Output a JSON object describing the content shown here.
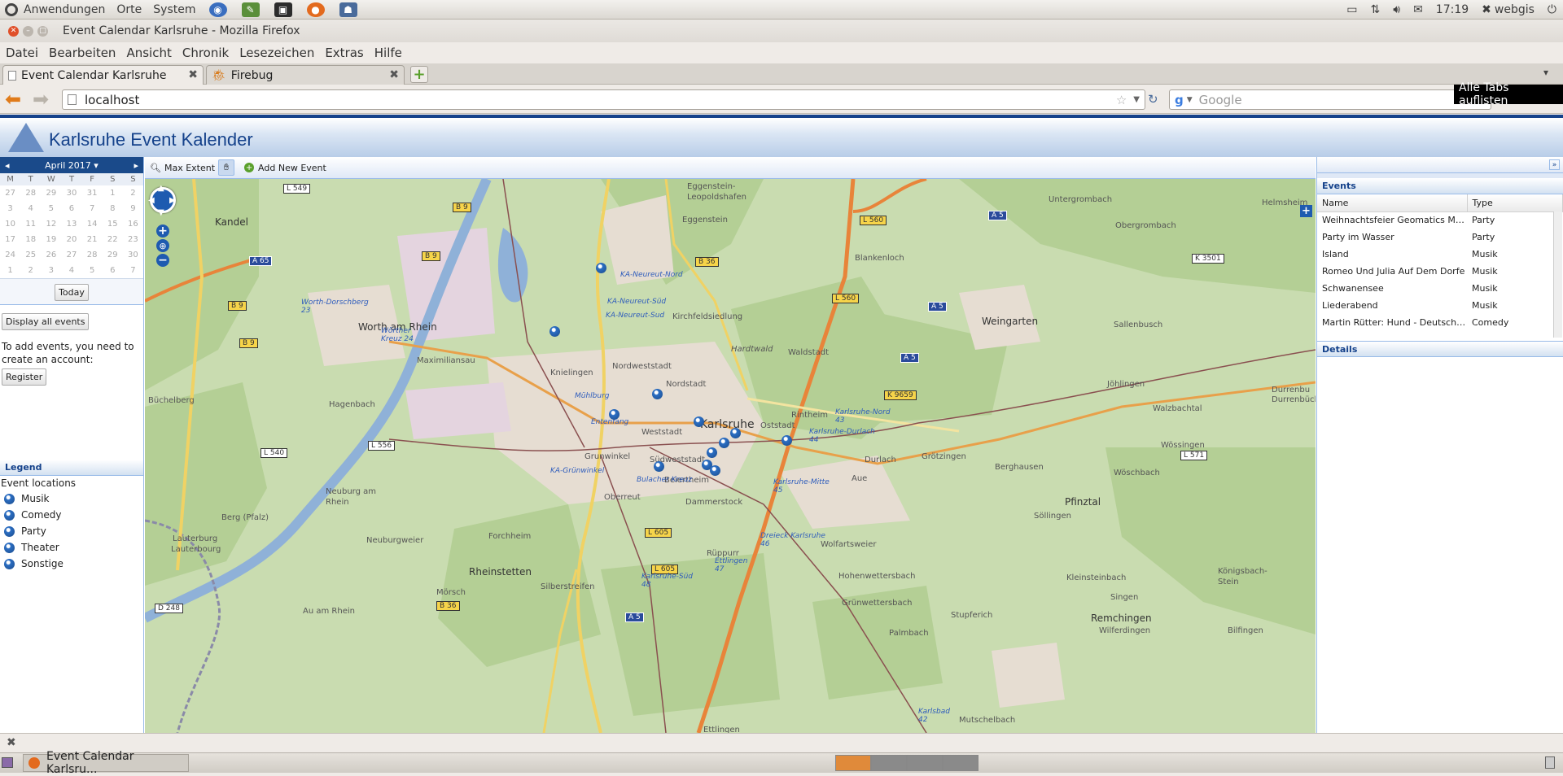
{
  "top_panel": {
    "menus": [
      "Anwendungen",
      "Orte",
      "System"
    ],
    "clock": "17:19",
    "user": "webgis"
  },
  "window": {
    "title": "Event Calendar Karlsruhe - Mozilla Firefox"
  },
  "menubar": [
    "Datei",
    "Bearbeiten",
    "Ansicht",
    "Chronik",
    "Lesezeichen",
    "Extras",
    "Hilfe"
  ],
  "tabs": [
    {
      "label": "Event Calendar Karlsruhe"
    },
    {
      "label": "Firebug"
    }
  ],
  "nav": {
    "url": "localhost",
    "search_placeholder": "Google",
    "tooltip": "Alle Tabs auflisten"
  },
  "app": {
    "title": "Karlsruhe Event Kalender"
  },
  "calendar": {
    "month": "April 2017",
    "weekdays": [
      "M",
      "T",
      "W",
      "T",
      "F",
      "S",
      "S"
    ],
    "weeks": [
      [
        "27",
        "28",
        "29",
        "30",
        "31",
        "1",
        "2"
      ],
      [
        "3",
        "4",
        "5",
        "6",
        "7",
        "8",
        "9"
      ],
      [
        "10",
        "11",
        "12",
        "13",
        "14",
        "15",
        "16"
      ],
      [
        "17",
        "18",
        "19",
        "20",
        "21",
        "22",
        "23"
      ],
      [
        "24",
        "25",
        "26",
        "27",
        "28",
        "29",
        "30"
      ],
      [
        "1",
        "2",
        "3",
        "4",
        "5",
        "6",
        "7"
      ]
    ],
    "today_label": "Today"
  },
  "sidebar": {
    "display_all_label": "Display all events",
    "account_note": "To add events, you need to create an account:",
    "register_label": "Register",
    "legend_title": "Legend",
    "legend_subtitle": "Event locations",
    "legend_items": [
      "Musik",
      "Comedy",
      "Party",
      "Theater",
      "Sonstige"
    ]
  },
  "map_toolbar": {
    "max_extent": "Max Extent",
    "add_event": "Add New Event"
  },
  "map": {
    "places": [
      "Kandel",
      "Worth am Rhein",
      "Maximiliansau",
      "Hagenbach",
      "Büchelberg",
      "Neuburg am Rhein",
      "Berg (Pfalz)",
      "Lauterburg",
      "Lauterbourg",
      "Au am Rhein",
      "Eggenstein-Leopoldshafen",
      "Eggenstein",
      "Blankenloch",
      "Karlsruhe",
      "Knielingen",
      "Nordweststadt",
      "Nordstadt",
      "Kirchfeldsiedlung",
      "Hardtwald",
      "Waldstadt",
      "Rintheim",
      "Oststadt",
      "Weststadt",
      "Grunwinkel",
      "Südweststadt",
      "Beiertheim",
      "Oberreut",
      "Dammerstock",
      "Durlach",
      "Aue",
      "Forchheim",
      "Rheinstetten",
      "Mörsch",
      "Silberstreifen",
      "Rüppurr",
      "Wolfartsweier",
      "Grötzingen",
      "Berghausen",
      "Söllingen",
      "Pfinztal",
      "Weingarten",
      "Sallenbusch",
      "Jöhlingen",
      "Walzbachtal",
      "Wössingen",
      "Wöschbach",
      "Hohenwettersbach",
      "Grünwettersbach",
      "Stupferich",
      "Palmbach",
      "Kleinsteinbach",
      "Singen",
      "Remchingen",
      "Wilferdingen",
      "Bilfingen",
      "Königsbach-Stein",
      "Untergrombach",
      "Obergrombach",
      "Helmsheim",
      "Durrenbu",
      "Mutschelbach",
      "Ettlingen",
      "Neuburgweier",
      "Durrenbüchig"
    ],
    "roads": [
      "L 549",
      "B 9",
      "A 65",
      "B 9",
      "B 9",
      "B 9",
      "L 540",
      "L 556",
      "B 36",
      "L 560",
      "L 560",
      "A 5",
      "A 5",
      "A 5",
      "K 9659",
      "K 3501",
      "L 571",
      "L 605",
      "L 605",
      "B 36",
      "A 5",
      "D 248"
    ],
    "tram_stops": [
      "Worth-Dorschberg 23",
      "Wörther Kreuz 24",
      "KA-Neureut-Nord",
      "KA-Neureut-Süd",
      "KA-Neureut-Sud",
      "Mühlburg",
      "Entenfang",
      "KA-Grünwinkel",
      "Bulacher Kreuz",
      "Karlsruhe-Nord 43",
      "Karlsruhe-Durlach 44",
      "Karlsruhe-Mitte 45",
      "Dreieck Karlsruhe 46",
      "Ettlingen 47",
      "Karlsruhe-Süd 48",
      "Karlsbad 42"
    ]
  },
  "events_panel": {
    "title": "Events",
    "columns": [
      "Name",
      "Type"
    ],
    "rows": [
      {
        "name": "Weihnachtsfeier Geomatics Master",
        "type": "Party"
      },
      {
        "name": "Party im Wasser",
        "type": "Party"
      },
      {
        "name": "Island",
        "type": "Musik"
      },
      {
        "name": "Romeo Und Julia Auf Dem Dorfe",
        "type": "Musik"
      },
      {
        "name": "Schwanensee",
        "type": "Musik"
      },
      {
        "name": "Liederabend",
        "type": "Musik"
      },
      {
        "name": "Martin Rütter: Hund - Deutsch / D...",
        "type": "Comedy"
      }
    ],
    "details_title": "Details"
  },
  "taskbar": {
    "window_label": "Event Calendar Karlsru..."
  },
  "colors": {
    "accent": "#15428b",
    "header_blue": "#b8cde8",
    "map_green": "#c9dcb0"
  }
}
